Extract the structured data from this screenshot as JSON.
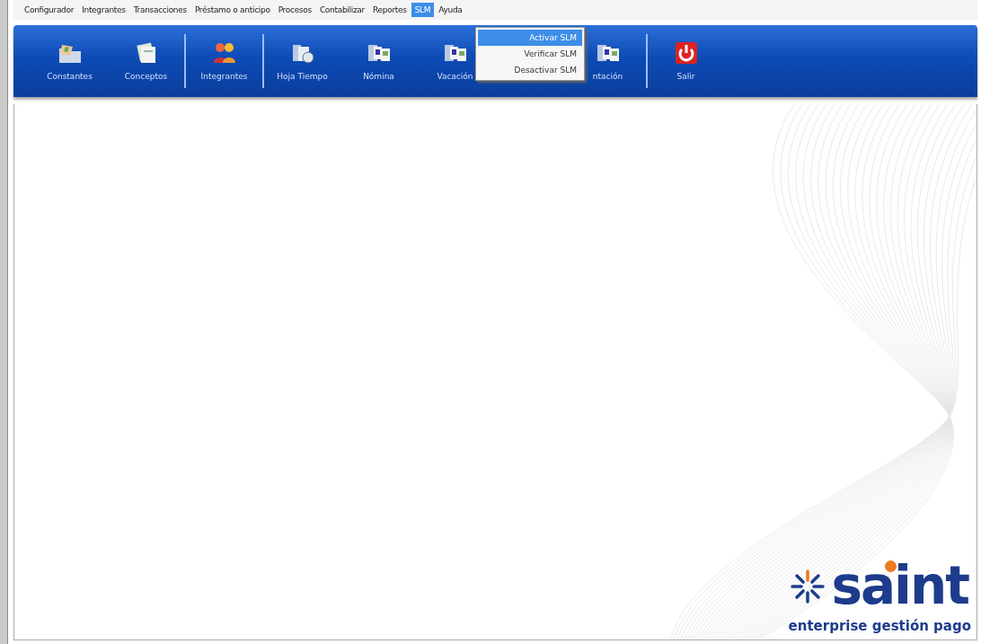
{
  "menu_bar": [
    {
      "label": "Configurador",
      "selected": false
    },
    {
      "label": "Integrantes",
      "selected": false
    },
    {
      "label": "Transacciones",
      "selected": false
    },
    {
      "label": "Préstamo o anticipo",
      "selected": false
    },
    {
      "label": "Procesos",
      "selected": false
    },
    {
      "label": "Contabilizar",
      "selected": false
    },
    {
      "label": "Reportes",
      "selected": false
    },
    {
      "label": "SLM",
      "selected": true
    },
    {
      "label": "Ayuda",
      "selected": false
    }
  ],
  "dropdown": {
    "items": [
      {
        "label": "Activar SLM",
        "selected": true
      },
      {
        "label": "Verificar SLM",
        "selected": false
      },
      {
        "label": "Desactivar SLM",
        "selected": false
      }
    ]
  },
  "toolbar": {
    "groups": [
      [
        {
          "label": "Constantes",
          "kind": "folder"
        },
        {
          "label": "Conceptos",
          "kind": "papers"
        }
      ],
      [
        {
          "label": "Integrantes",
          "kind": "people"
        }
      ],
      [
        {
          "label": "Hoja Tiempo",
          "kind": "clock"
        },
        {
          "label": "Nómina",
          "kind": "docs"
        },
        {
          "label": "Vacación",
          "kind": "docs"
        },
        {
          "kind": "hidden"
        },
        {
          "label": "ntación",
          "kind": "docs"
        }
      ],
      [
        {
          "label": "Salir",
          "kind": "power"
        }
      ]
    ]
  },
  "logo": {
    "name": "saint",
    "tagline": "enterprise gestión pago"
  }
}
